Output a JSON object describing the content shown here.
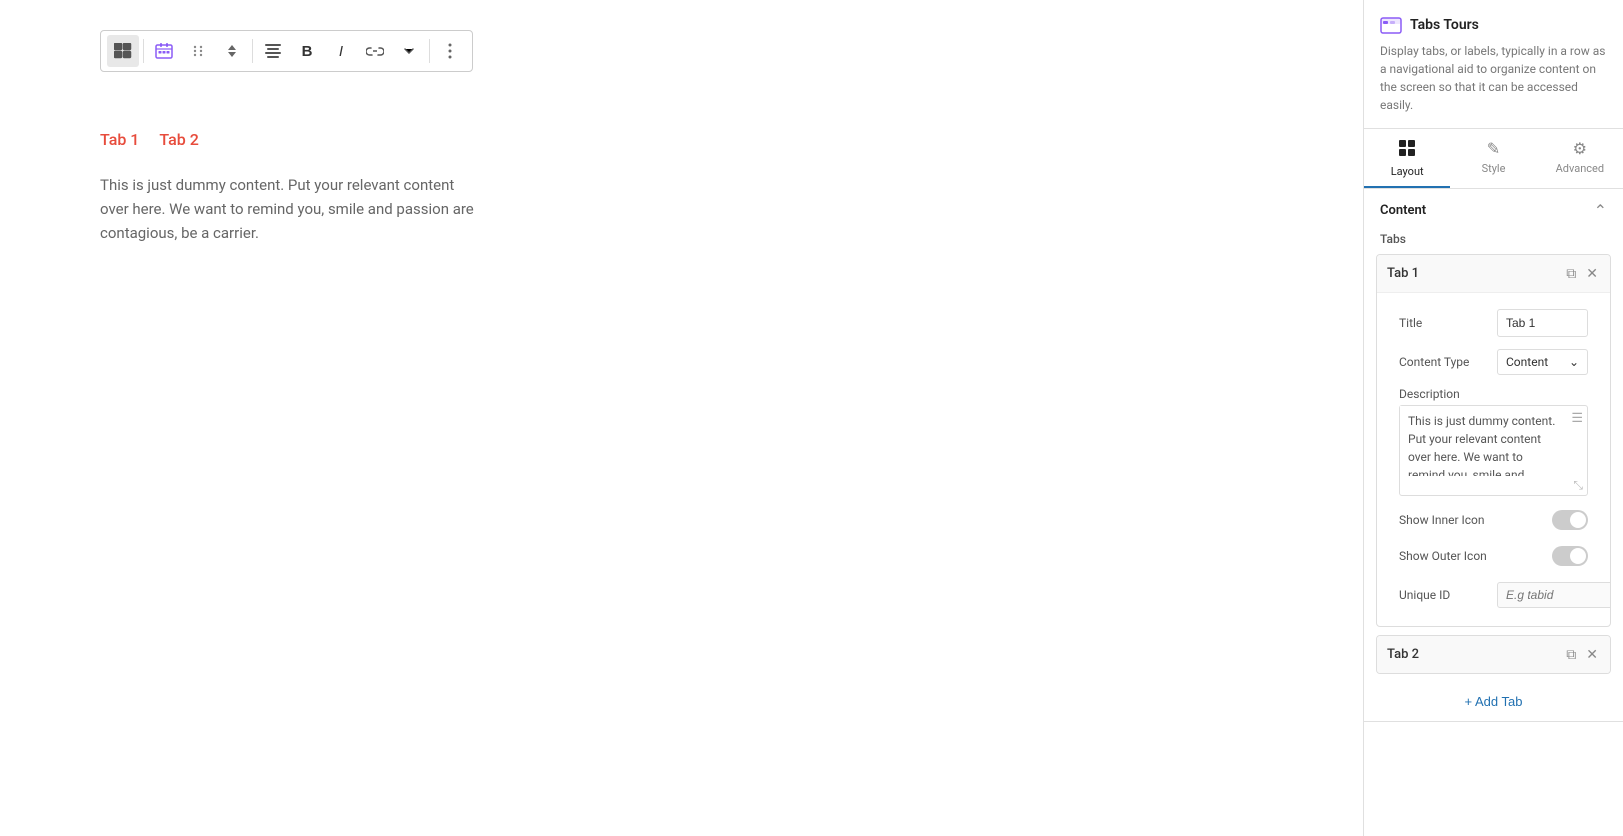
{
  "plugin": {
    "title": "Tabs Tours",
    "description": "Display tabs, or labels, typically in a row as a navigational aid to organize content on the screen so that it can be accessed easily."
  },
  "panel_tabs": [
    {
      "id": "layout",
      "label": "Layout",
      "icon": "▦",
      "active": true
    },
    {
      "id": "style",
      "label": "Style",
      "icon": "✎",
      "active": false
    },
    {
      "id": "advanced",
      "label": "Advanced",
      "icon": "⚙",
      "active": false
    }
  ],
  "content_section": {
    "title": "Content",
    "tabs_label": "Tabs"
  },
  "tab1": {
    "label": "Tab 1",
    "title_label": "Title",
    "title_value": "Tab 1",
    "content_type_label": "Content Type",
    "content_type_value": "Content",
    "description_label": "Description",
    "description_value": "This is just dummy content. Put your relevant content over here. We want to remind you, smile and",
    "show_inner_icon_label": "Show Inner Icon",
    "show_inner_icon": false,
    "show_outer_icon_label": "Show Outer Icon",
    "show_outer_icon": false,
    "unique_id_label": "Unique ID",
    "unique_id_placeholder": "E.g tabid"
  },
  "tab2": {
    "label": "Tab 2"
  },
  "add_tab_label": "+ Add Tab",
  "preview": {
    "tab1_label": "Tab 1",
    "tab2_label": "Tab 2",
    "content": "This is just dummy content. Put your relevant content over here. We want to remind you, smile and passion are contagious, be a carrier."
  },
  "toolbar": {
    "items": [
      "tabs",
      "move",
      "arrows",
      "align",
      "bold",
      "italic",
      "link",
      "chevron",
      "more"
    ]
  }
}
